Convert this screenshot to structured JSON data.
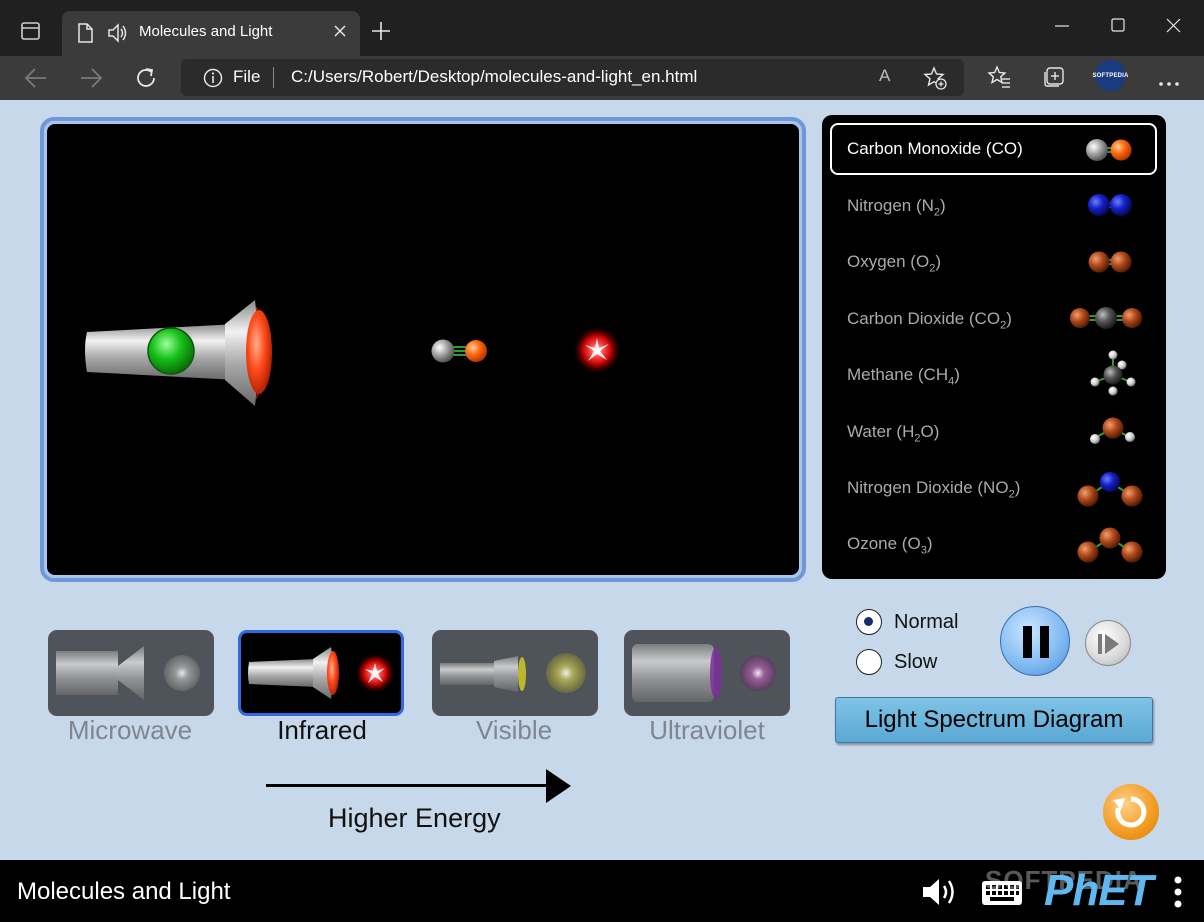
{
  "browser": {
    "tab_title": "Molecules and Light",
    "file_label": "File",
    "url": "C:/Users/Robert/Desktop/molecules-and-light_en.html",
    "read_aloud": "A",
    "profile_badge": "SOFTPEDIA"
  },
  "molecules": [
    {
      "name": "Carbon Monoxide (CO)",
      "selected": true
    },
    {
      "name_html": "Nitrogen (N<sub>2</sub>)"
    },
    {
      "name_html": "Oxygen (O<sub>2</sub>)"
    },
    {
      "name_html": "Carbon Dioxide (CO<sub>2</sub>)"
    },
    {
      "name_html": "Methane (CH<sub>4</sub>)"
    },
    {
      "name_html": "Water (H<sub>2</sub>O)"
    },
    {
      "name_html": "Nitrogen Dioxide (NO<sub>2</sub>)"
    },
    {
      "name_html": "Ozone (O<sub>3</sub>)"
    }
  ],
  "emitters": {
    "microwave": "Microwave",
    "infrared": "Infrared",
    "visible": "Visible",
    "ultraviolet": "Ultraviolet",
    "selected": "Infrared"
  },
  "energy_label": "Higher Energy",
  "speed": {
    "normal": "Normal",
    "slow": "Slow",
    "selected": "Normal"
  },
  "spectrum_button": "Light Spectrum Diagram",
  "footer": {
    "sim_title": "Molecules and Light",
    "logo": "PhET",
    "watermark": "SOFTPEDIA"
  },
  "colors": {
    "sim_bg": "#c6d8ea",
    "selected_border": "#2f6be0",
    "spectrum_button": "#6bb6de",
    "reset": "#f29a1e"
  }
}
